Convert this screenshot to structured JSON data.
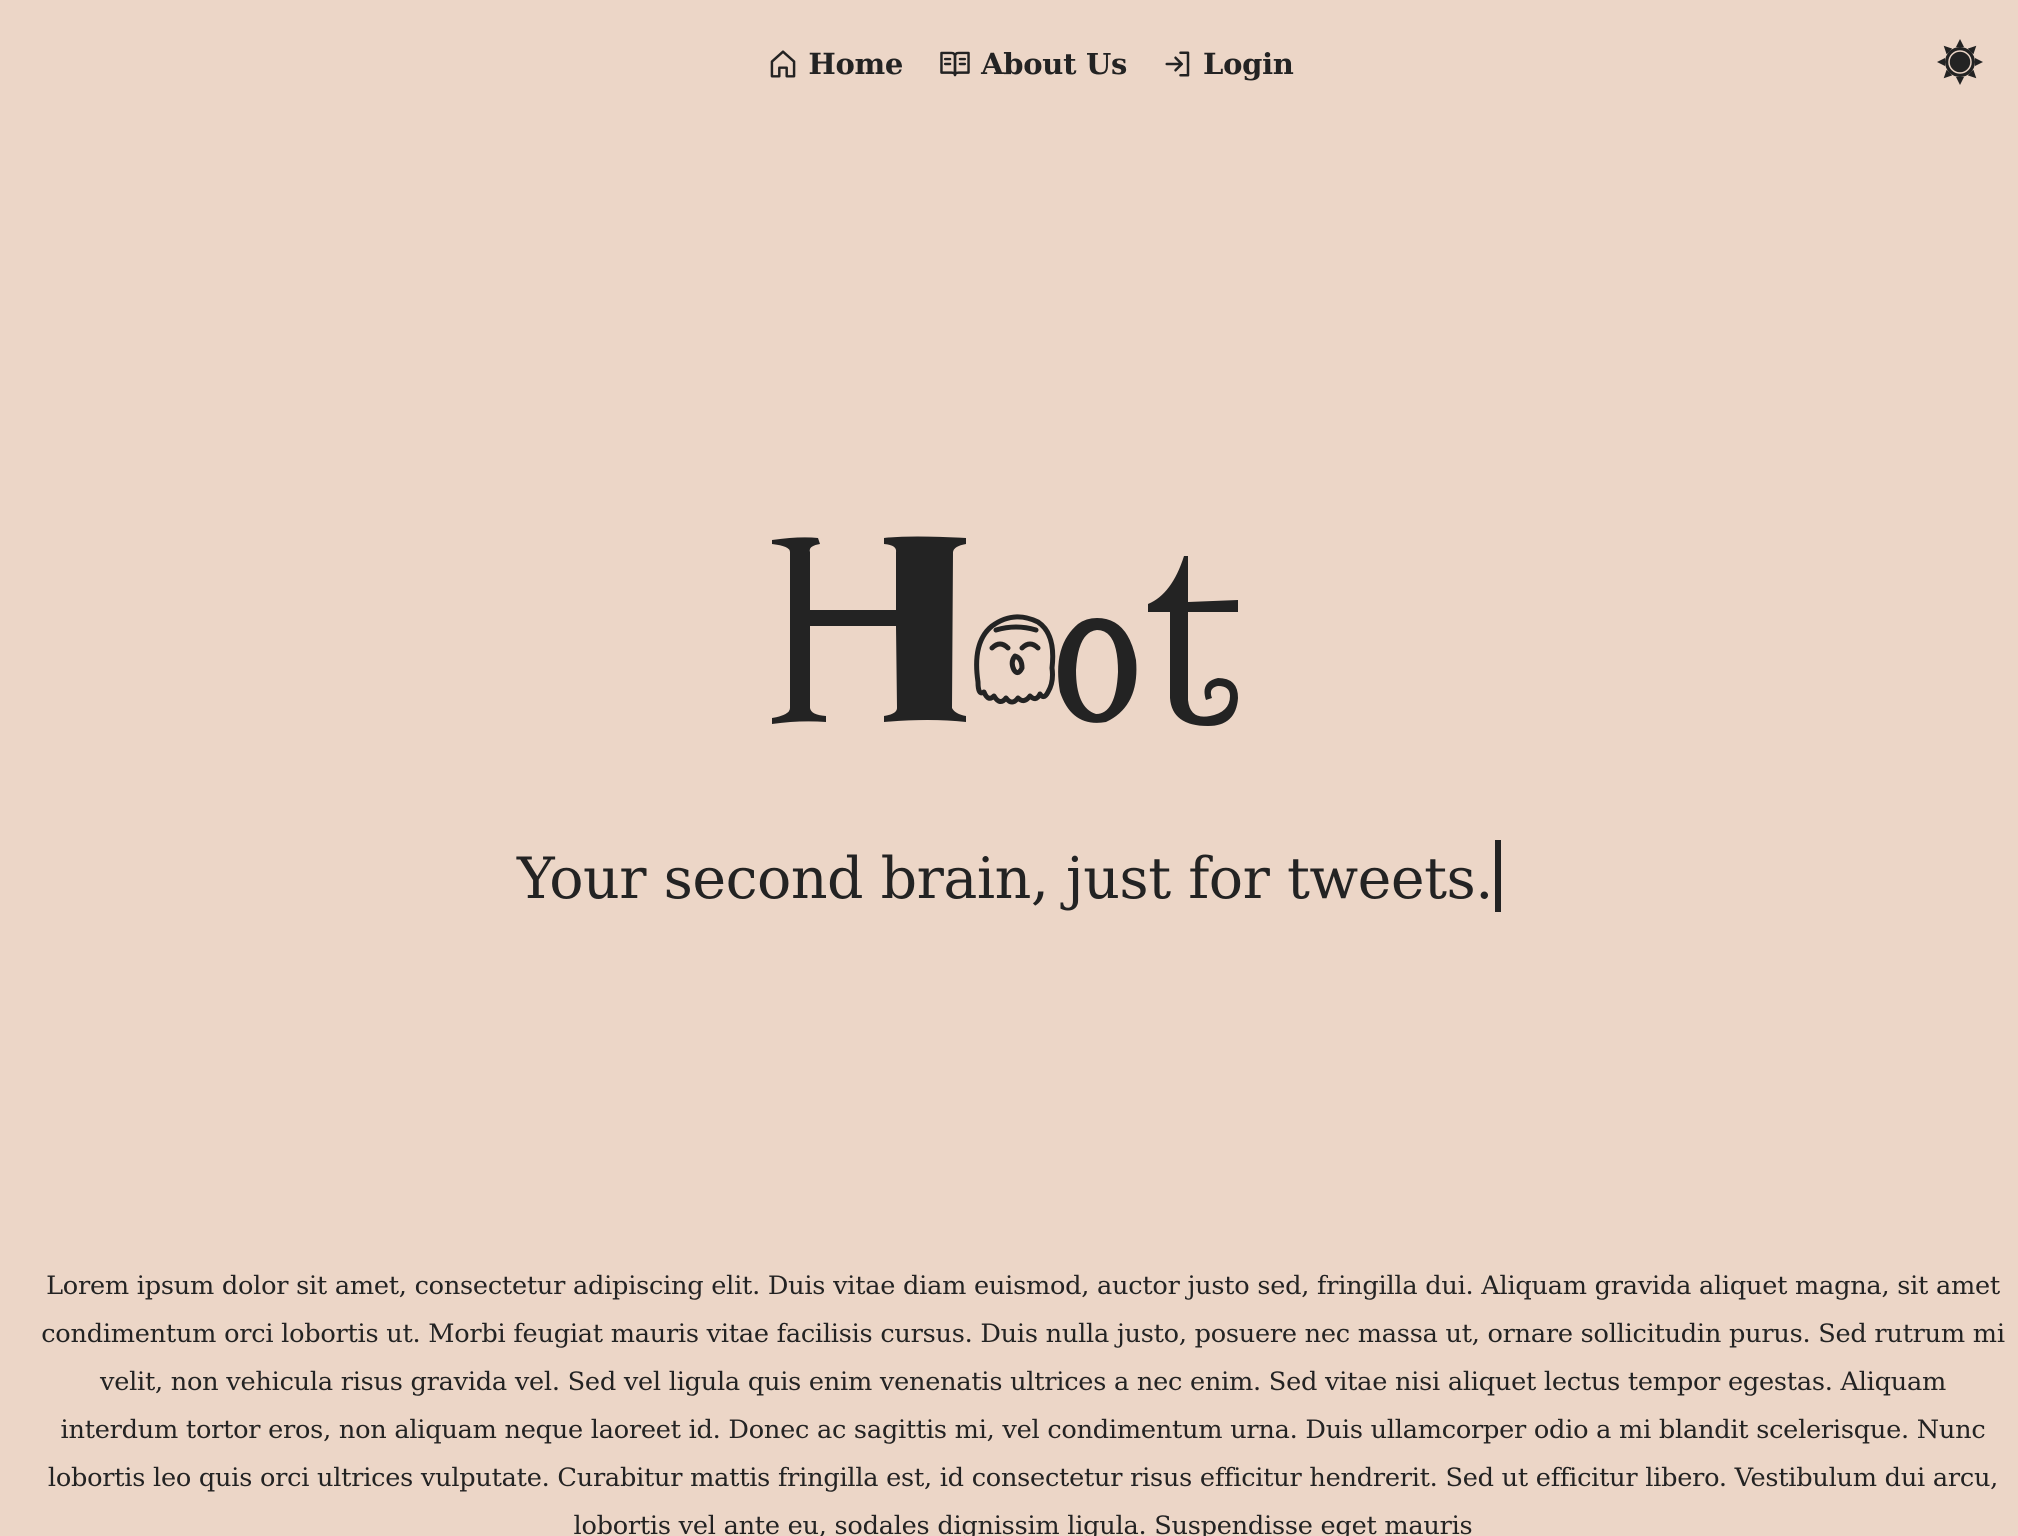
{
  "nav": {
    "items": [
      {
        "label": "Home",
        "icon": "home-icon"
      },
      {
        "label": "About Us",
        "icon": "book-icon"
      },
      {
        "label": "Login",
        "icon": "login-icon"
      }
    ],
    "theme_toggle_icon": "sun-icon"
  },
  "hero": {
    "logo_text": "Hoot",
    "tagline": "Your second brain, just for tweets."
  },
  "body": {
    "paragraph": "Lorem ipsum dolor sit amet, consectetur adipiscing elit. Duis vitae diam euismod, auctor justo sed, fringilla dui. Aliquam gravida aliquet magna, sit amet condimentum orci lobortis ut. Morbi feugiat mauris vitae facilisis cursus. Duis nulla justo, posuere nec massa ut, ornare sollicitudin purus. Sed rutrum mi velit, non vehicula risus gravida vel. Sed vel ligula quis enim venenatis ultrices a nec enim. Sed vitae nisi aliquet lectus tempor egestas. Aliquam interdum tortor eros, non aliquam neque laoreet id. Donec ac sagittis mi, vel condimentum urna. Duis ullamcorper odio a mi blandit scelerisque. Nunc lobortis leo quis orci ultrices vulputate. Curabitur mattis fringilla est, id consectetur risus efficitur hendrerit. Sed ut efficitur libero. Vestibulum dui arcu, lobortis vel ante eu, sodales dignissim ligula. Suspendisse eget mauris"
  },
  "colors": {
    "background": "#ecd6c7",
    "text": "#232323"
  }
}
